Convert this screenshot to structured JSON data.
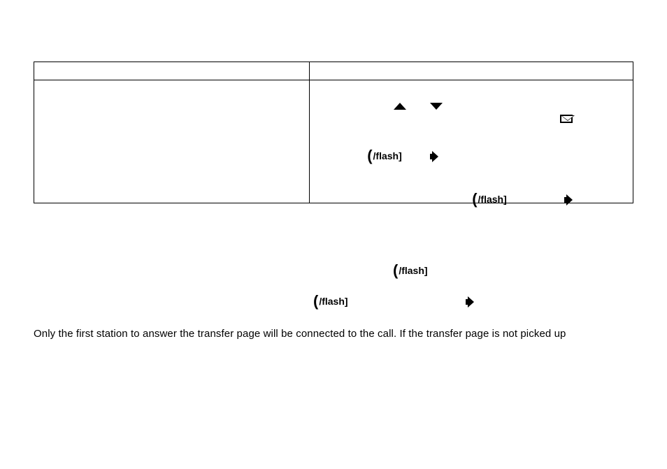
{
  "table": {
    "flash_label": "/flash]"
  },
  "below": {
    "flash_label": "/flash]",
    "body_text": "Only the first station to answer the transfer page will be connected to the call. If the transfer page is not picked up"
  }
}
